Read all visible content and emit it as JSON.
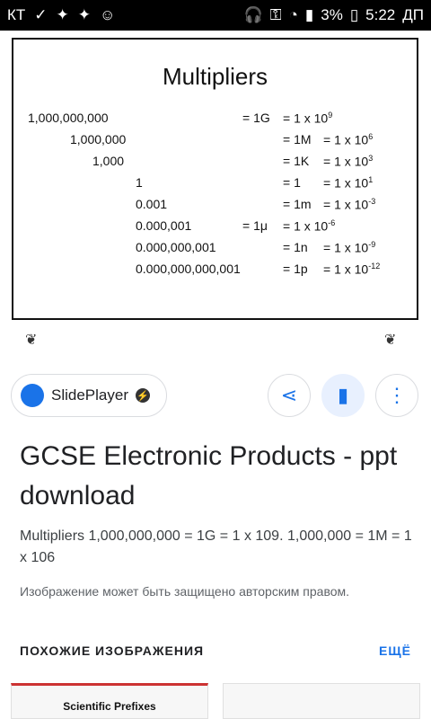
{
  "statusbar": {
    "carrier": "КТ",
    "battery": "3%",
    "time": "5:22",
    "ampm": "ДП"
  },
  "slide": {
    "title": "Multipliers",
    "rows": [
      {
        "num": "1,000,000,000",
        "eq": "= 1G",
        "pow": "= 1 x 10",
        "exp": "9"
      },
      {
        "num": "1,000,000",
        "eq": "= 1M",
        "pow": "= 1 x 10",
        "exp": "6"
      },
      {
        "num": "1,000",
        "eq": "= 1K",
        "pow": "= 1 x 10",
        "exp": "3"
      },
      {
        "num": "1",
        "eq": "= 1",
        "pow": "= 1 x 10",
        "exp": "1"
      },
      {
        "num": "0.001",
        "eq": "= 1m",
        "pow": "= 1 x 10",
        "exp": "-3"
      },
      {
        "num": "0.000,001",
        "eq": "= 1μ",
        "pow": "= 1 x 10",
        "exp": "-6"
      },
      {
        "num": "0.000,000,001",
        "eq": "= 1n",
        "pow": "= 1 x 10",
        "exp": "-9"
      },
      {
        "num": "0.000,000,000,001",
        "eq": "= 1p",
        "pow": "= 1 x 10",
        "exp": "-12"
      }
    ]
  },
  "source_chip": {
    "label": "SlidePlayer"
  },
  "result": {
    "title": "GCSE Electronic Products - ppt download",
    "description": "Multipliers 1,000,000,000 = 1G = 1 x 109. 1,000,000 = 1M = 1 x 106",
    "copyright": "Изображение может быть защищено авторским правом."
  },
  "similar": {
    "heading": "ПОХОЖИЕ ИЗОБРАЖЕНИЯ",
    "more": "ЕЩЁ",
    "thumb1_title": "Scientific Prefixes"
  }
}
